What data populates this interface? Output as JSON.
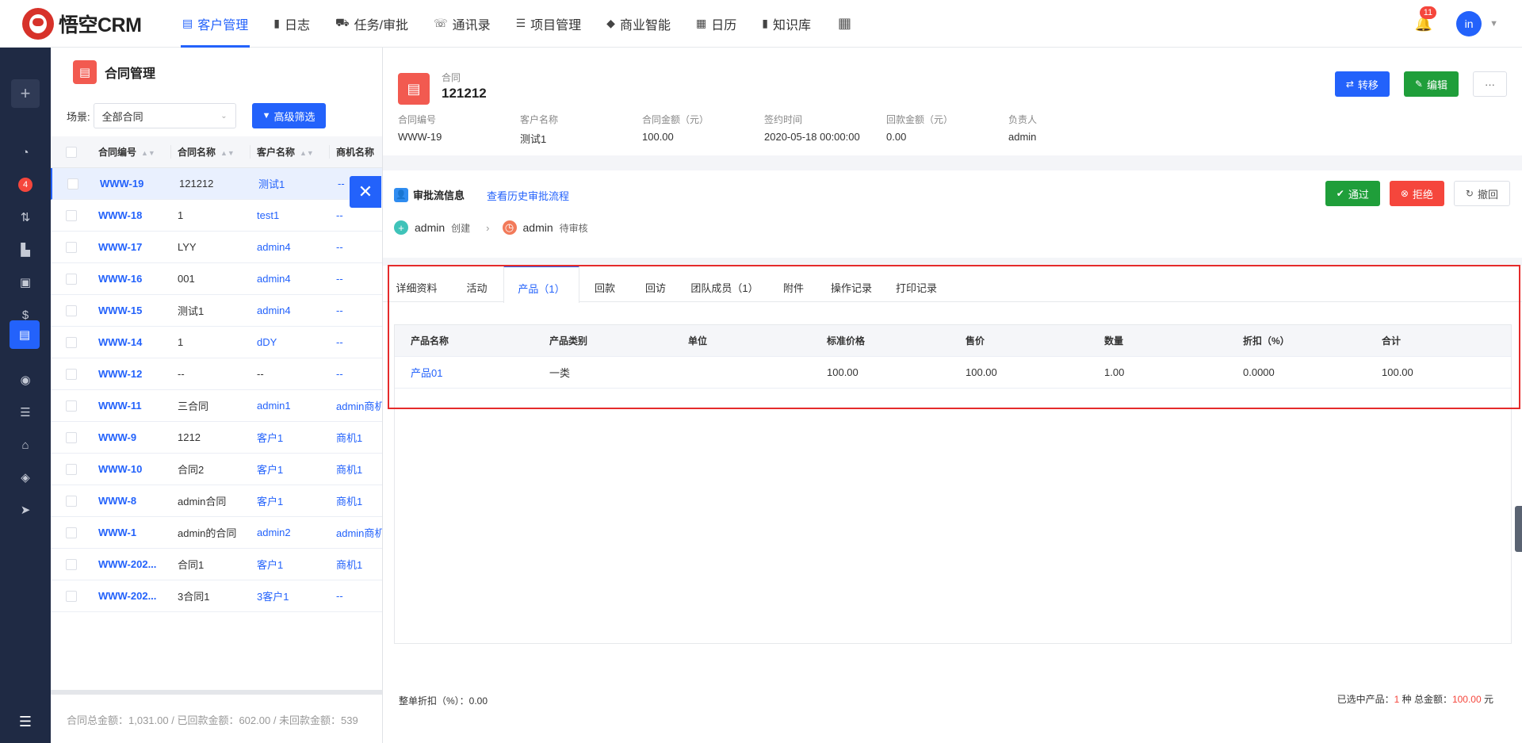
{
  "app": {
    "name": "悟空CRM"
  },
  "nav": [
    {
      "label": "客户管理",
      "icon": "customer-icon",
      "active": true
    },
    {
      "label": "日志",
      "icon": "log-icon"
    },
    {
      "label": "任务/审批",
      "icon": "task-icon"
    },
    {
      "label": "通讯录",
      "icon": "contacts-icon"
    },
    {
      "label": "项目管理",
      "icon": "project-icon"
    },
    {
      "label": "商业智能",
      "icon": "bi-icon"
    },
    {
      "label": "日历",
      "icon": "calendar-icon"
    },
    {
      "label": "知识库",
      "icon": "knowledge-icon"
    }
  ],
  "user": {
    "notifications": "11",
    "avatar_text": "in"
  },
  "sidebar": {
    "badge": "4",
    "active_index": 6
  },
  "list": {
    "title": "合同管理",
    "scene_label": "场景:",
    "scene_value": "全部合同",
    "advanced_filter": "高级筛选",
    "columns": [
      "合同编号",
      "合同名称",
      "客户名称",
      "商机名称"
    ],
    "rows": [
      {
        "code": "WWW-19",
        "name": "121212",
        "customer": "测试1",
        "opp": "--",
        "selected": true
      },
      {
        "code": "WWW-18",
        "name": "1",
        "customer": "test1",
        "opp": "--"
      },
      {
        "code": "WWW-17",
        "name": "LYY",
        "customer": "admin4",
        "opp": "--"
      },
      {
        "code": "WWW-16",
        "name": "001",
        "customer": "admin4",
        "opp": "--"
      },
      {
        "code": "WWW-15",
        "name": "测试1",
        "customer": "admin4",
        "opp": "--"
      },
      {
        "code": "WWW-14",
        "name": "1",
        "customer": "dDY",
        "opp": "--"
      },
      {
        "code": "WWW-12",
        "name": "--",
        "customer": "--",
        "opp": "--"
      },
      {
        "code": "WWW-11",
        "name": "三合同",
        "customer": "admin1",
        "opp": "admin商机"
      },
      {
        "code": "WWW-9",
        "name": "1212",
        "customer": "客户1",
        "opp": "商机1"
      },
      {
        "code": "WWW-10",
        "name": "合同2",
        "customer": "客户1",
        "opp": "商机1"
      },
      {
        "code": "WWW-8",
        "name": "admin合同",
        "customer": "客户1",
        "opp": "商机1"
      },
      {
        "code": "WWW-1",
        "name": "admin的合同",
        "customer": "admin2",
        "opp": "admin商机"
      },
      {
        "code": "WWW-202...",
        "name": "合同1",
        "customer": "客户1",
        "opp": "商机1"
      },
      {
        "code": "WWW-202...",
        "name": "3合同1",
        "customer": "3客户1",
        "opp": "--"
      }
    ],
    "footer": "合同总金额：1,031.00 / 已回款金额：602.00 / 未回款金额：539"
  },
  "detail": {
    "type_label": "合同",
    "name": "121212",
    "actions": {
      "transfer": "转移",
      "edit": "编辑",
      "more": "···"
    },
    "info": [
      {
        "key": "合同编号",
        "value": "WWW-19"
      },
      {
        "key": "客户名称",
        "value": "测试1"
      },
      {
        "key": "合同金额（元）",
        "value": "100.00"
      },
      {
        "key": "签约时间",
        "value": "2020-05-18 00:00:00"
      },
      {
        "key": "回款金额（元）",
        "value": "0.00"
      },
      {
        "key": "负责人",
        "value": "admin"
      }
    ],
    "approval": {
      "title": "审批流信息",
      "history_link": "查看历史审批流程",
      "approve": "通过",
      "reject": "拒绝",
      "revoke": "撤回",
      "steps": [
        {
          "user": "admin",
          "status": "创建"
        },
        {
          "user": "admin",
          "status": "待审核"
        }
      ]
    },
    "tabs": [
      "详细资料",
      "活动",
      "产品（1）",
      "回款",
      "回访",
      "团队成员（1）",
      "附件",
      "操作记录",
      "打印记录"
    ],
    "active_tab": 2,
    "product_columns": [
      "产品名称",
      "产品类别",
      "单位",
      "标准价格",
      "售价",
      "数量",
      "折扣（%）",
      "合计"
    ],
    "products": [
      {
        "name": "产品01",
        "category": "一类",
        "unit": "",
        "std_price": "100.00",
        "price": "100.00",
        "qty": "1.00",
        "discount": "0.0000",
        "total": "100.00"
      }
    ],
    "summary_left": "整单折扣（%）：0.00",
    "summary_right_prefix": "已选中产品：",
    "summary_count": "1",
    "summary_mid": " 种  总金额：",
    "summary_amount": "100.00",
    "summary_unit": " 元"
  },
  "colors": {
    "primary": "#2362fb",
    "success": "#1f9e3a",
    "danger": "#f5463c",
    "highlight": "#e52b2b"
  }
}
